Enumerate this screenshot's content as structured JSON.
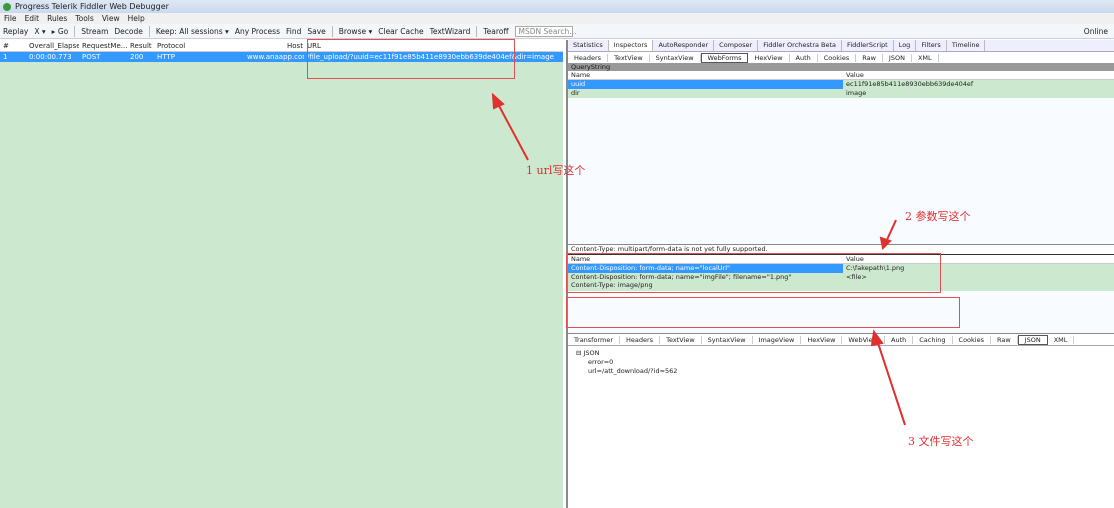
{
  "title": "Progress Telerik Fiddler Web Debugger",
  "menu": [
    "File",
    "Edit",
    "Rules",
    "Tools",
    "View",
    "Help"
  ],
  "toolbar": [
    "Replay",
    "X ▾",
    "▸ Go",
    "Stream",
    "Decode",
    "Keep: All sessions ▾",
    "Any Process",
    "Find",
    "Save",
    "Browse ▾",
    "Clear Cache",
    "TextWizard",
    "Tearoff"
  ],
  "search_placeholder": "MSDN Search...",
  "online": "Online",
  "sessions": {
    "headers": [
      "#",
      "Overall_Elapsed",
      "RequestMe...",
      "Result",
      "Protocol",
      "Host",
      "URL"
    ],
    "rows": [
      [
        "1",
        "0:00:00.773",
        "POST",
        "200",
        "HTTP",
        "www.anaapp.com",
        "/file_upload/?uuid=ec11f91e85b411e8930ebb639de404ef&dir=image"
      ]
    ]
  },
  "inspector_tabs": [
    "Statistics",
    "Inspectors",
    "AutoResponder",
    "Composer",
    "Fiddler Orchestra Beta",
    "FiddlerScript",
    "Log",
    "Filters",
    "Timeline"
  ],
  "request_tabs": [
    "Headers",
    "TextView",
    "SyntaxView",
    "WebForms",
    "HexView",
    "Auth",
    "Cookies",
    "Raw",
    "JSON",
    "XML"
  ],
  "querystring": {
    "title": "QueryString",
    "headers": [
      "Name",
      "Value"
    ],
    "rows": [
      [
        "uuid",
        "ec11f91e85b411e8930ebb639de404ef"
      ],
      [
        "dir",
        "image"
      ]
    ]
  },
  "body": {
    "notice": "Content-Type: multipart/form-data is not yet fully supported.",
    "headers": [
      "Name",
      "Value"
    ],
    "rows": [
      [
        "Content-Disposition: form-data; name=\"localUrl\"",
        "C:\\fakepath\\1.png"
      ],
      [
        "Content-Disposition: form-data; name=\"imgFile\"; filename=\"1.png\"\nContent-Type: image/png",
        "<file>"
      ]
    ]
  },
  "response_tabs": [
    "Transformer",
    "Headers",
    "TextView",
    "SyntaxView",
    "ImageView",
    "HexView",
    "WebView",
    "Auth",
    "Caching",
    "Cookies",
    "Raw",
    "JSON",
    "XML"
  ],
  "json_tree": {
    "root": "JSON",
    "items": [
      "error=0",
      "url=/att_download/?id=562"
    ]
  },
  "annotations": [
    "1 url写这个",
    "2 参数写这个",
    "3 文件写这个"
  ]
}
